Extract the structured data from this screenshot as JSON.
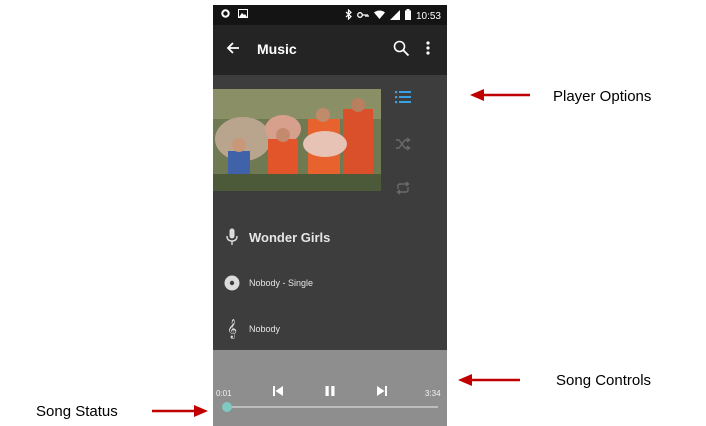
{
  "status_bar": {
    "time": "10:53",
    "icons": [
      "settings-icon",
      "image-icon",
      "bluetooth-icon",
      "key-icon",
      "wifi-icon",
      "signal-icon",
      "battery-icon"
    ]
  },
  "app_bar": {
    "title": "Music",
    "icons": [
      "back-arrow-icon",
      "search-icon",
      "more-vert-icon"
    ]
  },
  "player_options": {
    "icons": [
      "queue-list-icon",
      "shuffle-icon",
      "repeat-icon"
    ],
    "accent_color": "#3aa0e0"
  },
  "track_info": {
    "artist": "Wonder Girls",
    "album": "Nobody - Single",
    "song": "Nobody"
  },
  "controls": {
    "icons": [
      "skip-previous-icon",
      "pause-icon",
      "skip-next-icon"
    ],
    "elapsed": "0:01",
    "duration": "3:34",
    "progress_fraction": 0.005
  },
  "annotations": {
    "player_options": "Player Options",
    "song_controls": "Song Controls",
    "song_status": "Song Status",
    "arrow_color": "#c00000"
  }
}
